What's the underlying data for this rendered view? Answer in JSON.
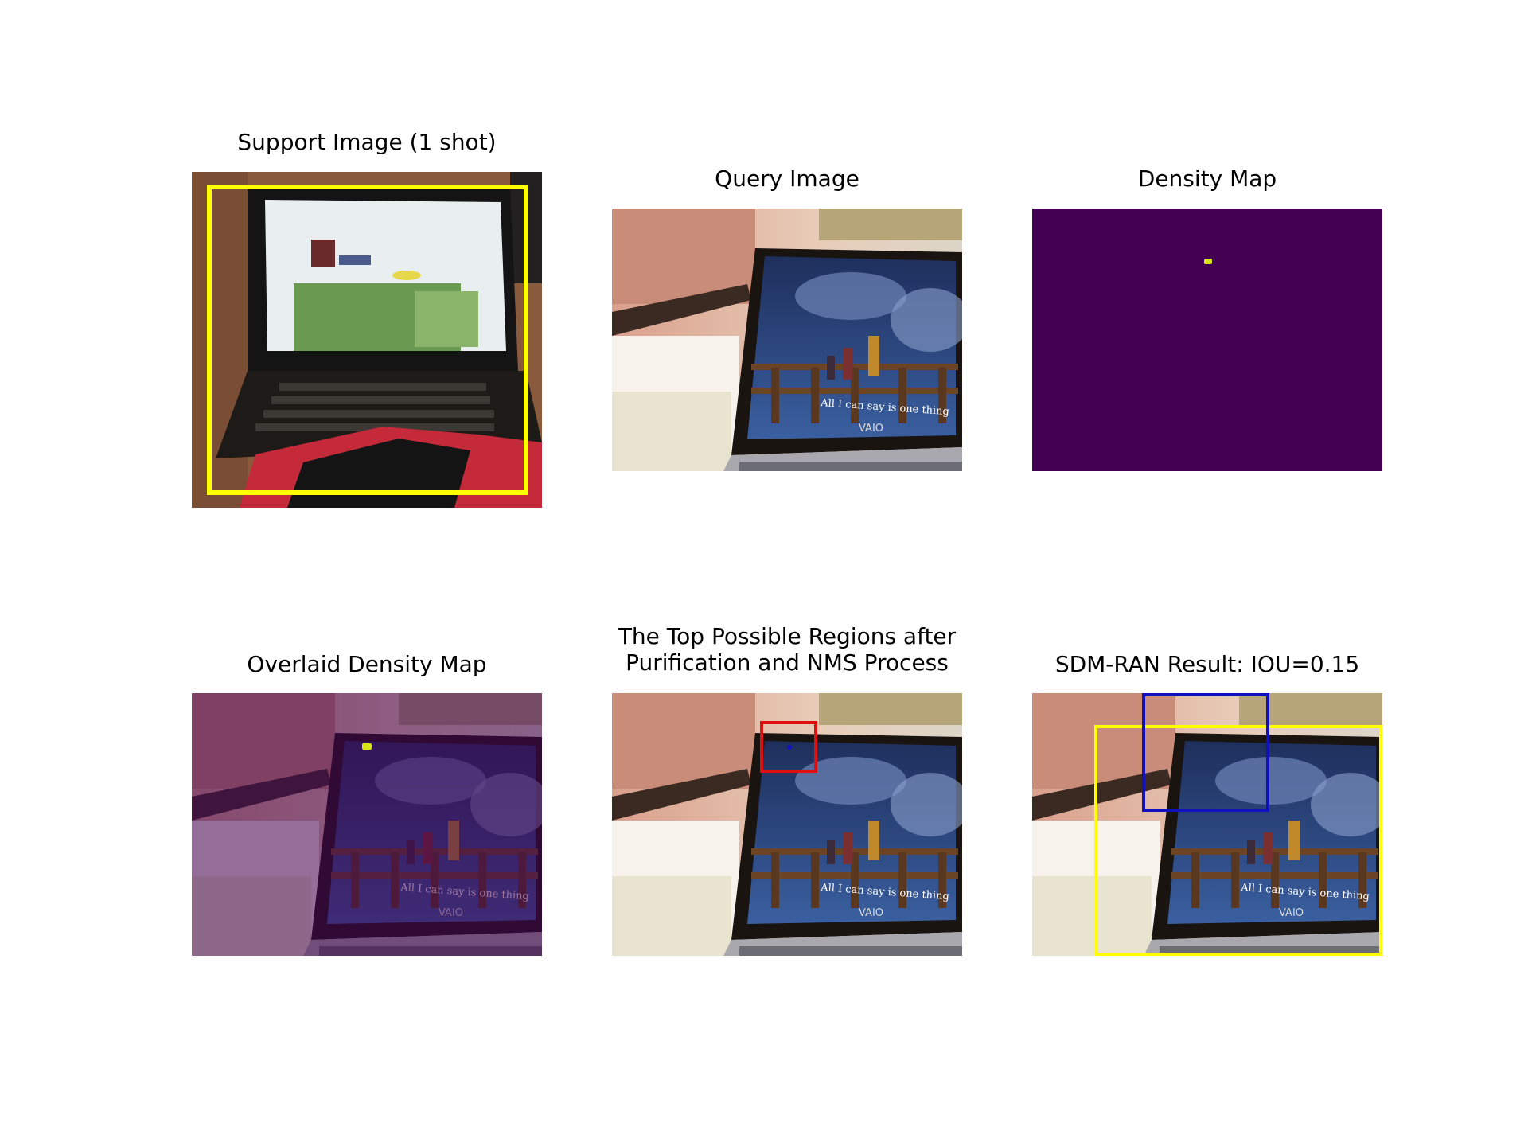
{
  "panels": [
    {
      "title": "Support Image (1 shot)"
    },
    {
      "title": "Query Image"
    },
    {
      "title": "Density Map"
    },
    {
      "title": "Overlaid Density Map"
    },
    {
      "title": "The Top Possible Regions after Purification and NMS Process"
    },
    {
      "title": "SDM-RAN Result: IOU=0.15"
    }
  ],
  "screen_text": "All I can say is one thing",
  "brand_text": "VAIO",
  "colors": {
    "viridis_low": "#440154",
    "viridis_high": "#d8e219",
    "support_box": "#ffff00",
    "region_box": "#e01010",
    "prediction_box": "#1010c0",
    "ground_truth_box": "#ffff00"
  }
}
